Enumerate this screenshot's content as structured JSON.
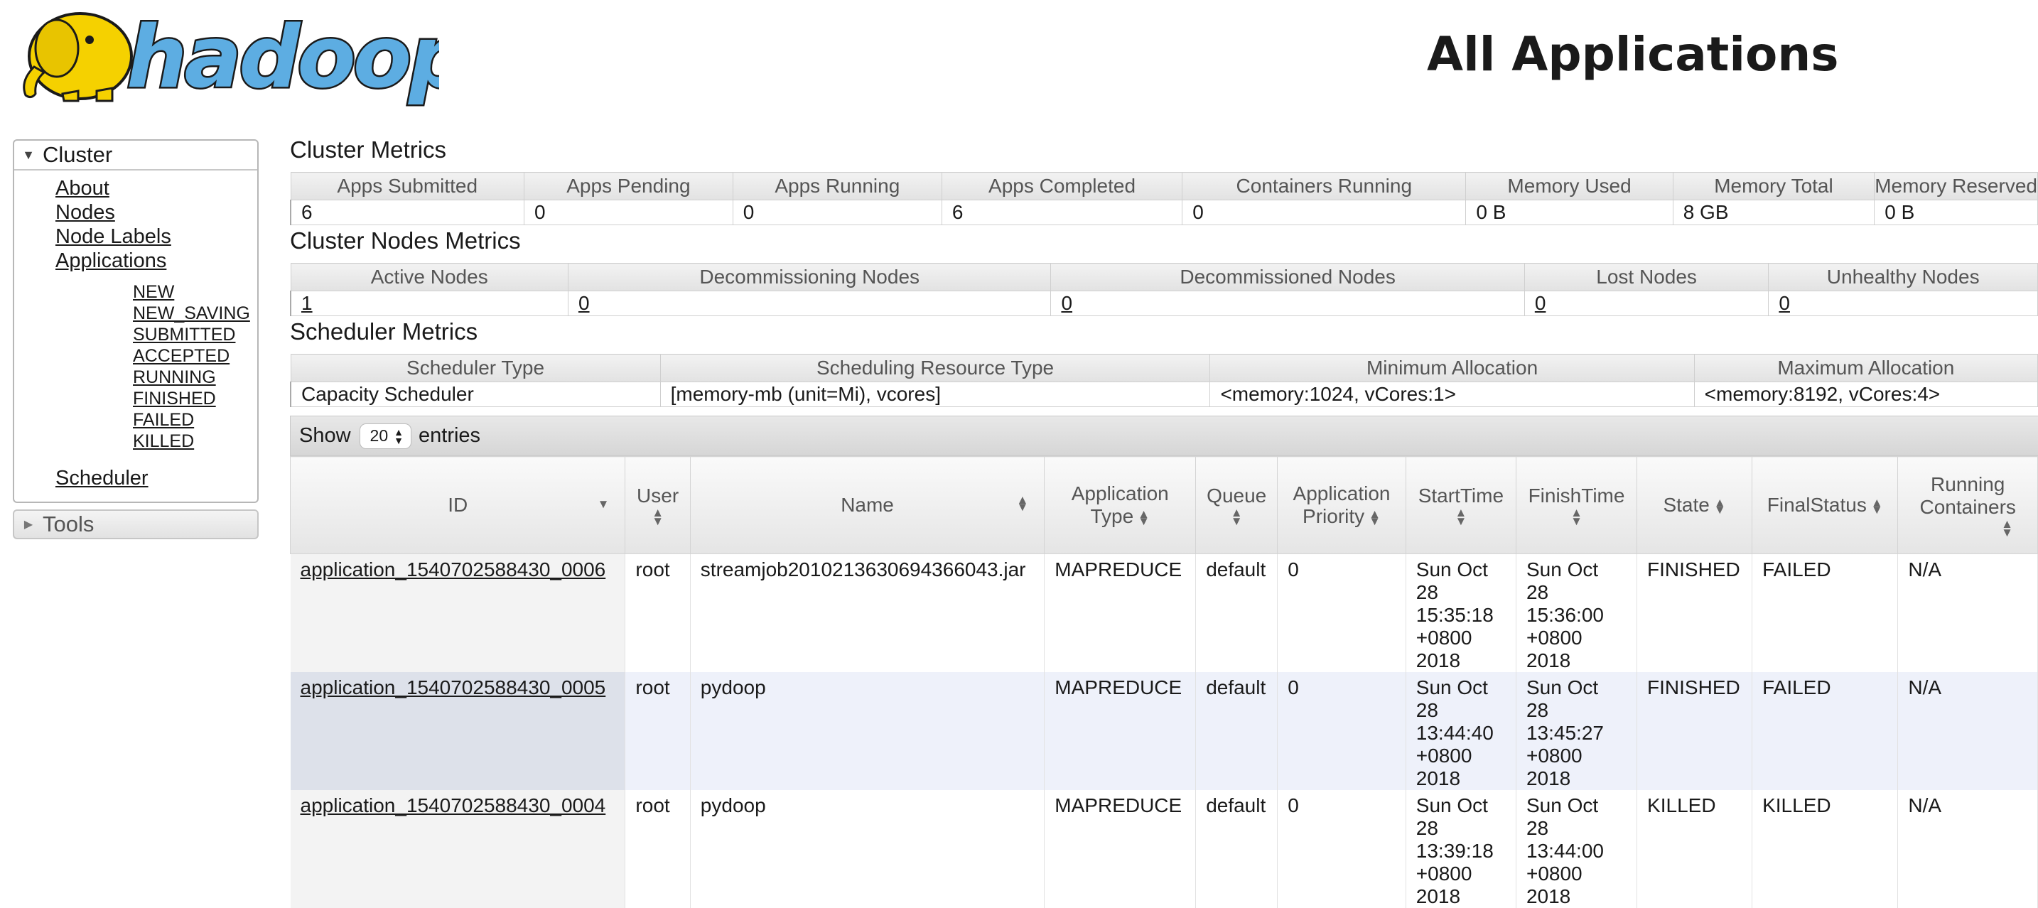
{
  "header": {
    "title": "All Applications",
    "logo_text": "hadoop"
  },
  "sidebar": {
    "cluster_label": "Cluster",
    "links": [
      "About",
      "Nodes",
      "Node Labels",
      "Applications"
    ],
    "app_states": [
      "NEW",
      "NEW_SAVING",
      "SUBMITTED",
      "ACCEPTED",
      "RUNNING",
      "FINISHED",
      "FAILED",
      "KILLED"
    ],
    "scheduler_label": "Scheduler",
    "tools_label": "Tools"
  },
  "cluster_metrics": {
    "title": "Cluster Metrics",
    "headers": [
      "Apps Submitted",
      "Apps Pending",
      "Apps Running",
      "Apps Completed",
      "Containers Running",
      "Memory Used",
      "Memory Total",
      "Memory Reserved"
    ],
    "values": [
      "6",
      "0",
      "0",
      "6",
      "0",
      "0 B",
      "8 GB",
      "0 B"
    ]
  },
  "node_metrics": {
    "title": "Cluster Nodes Metrics",
    "headers": [
      "Active Nodes",
      "Decommissioning Nodes",
      "Decommissioned Nodes",
      "Lost Nodes",
      "Unhealthy Nodes"
    ],
    "values": [
      "1",
      "0",
      "0",
      "0",
      "0"
    ]
  },
  "scheduler_metrics": {
    "title": "Scheduler Metrics",
    "headers": [
      "Scheduler Type",
      "Scheduling Resource Type",
      "Minimum Allocation",
      "Maximum Allocation"
    ],
    "values": [
      "Capacity Scheduler",
      "[memory-mb (unit=Mi), vcores]",
      "<memory:1024, vCores:1>",
      "<memory:8192, vCores:4>"
    ]
  },
  "entries": {
    "show_label": "Show",
    "count": "20",
    "suffix": "entries"
  },
  "apps_table": {
    "columns": [
      {
        "lines": [
          "ID"
        ]
      },
      {
        "lines": [
          "User"
        ]
      },
      {
        "lines": [
          "Name"
        ]
      },
      {
        "lines": [
          "Application",
          "Type"
        ]
      },
      {
        "lines": [
          "Queue"
        ]
      },
      {
        "lines": [
          "Application",
          "Priority"
        ]
      },
      {
        "lines": [
          "StartTime"
        ]
      },
      {
        "lines": [
          "FinishTime"
        ]
      },
      {
        "lines": [
          "State"
        ]
      },
      {
        "lines": [
          "FinalStatus"
        ]
      },
      {
        "lines": [
          "Running",
          "Containers"
        ]
      }
    ],
    "rows": [
      {
        "id": "application_1540702588430_0006",
        "user": "root",
        "name": "streamjob2010213630694366043.jar",
        "type": "MAPREDUCE",
        "queue": "default",
        "priority": "0",
        "start": [
          "Sun Oct",
          "28",
          "15:35:18",
          "+0800",
          "2018"
        ],
        "finish": [
          "Sun Oct",
          "28",
          "15:36:00",
          "+0800",
          "2018"
        ],
        "state": "FINISHED",
        "final_status": "FAILED",
        "running_containers": "N/A"
      },
      {
        "id": "application_1540702588430_0005",
        "user": "root",
        "name": "pydoop",
        "type": "MAPREDUCE",
        "queue": "default",
        "priority": "0",
        "start": [
          "Sun Oct",
          "28",
          "13:44:40",
          "+0800",
          "2018"
        ],
        "finish": [
          "Sun Oct",
          "28",
          "13:45:27",
          "+0800",
          "2018"
        ],
        "state": "FINISHED",
        "final_status": "FAILED",
        "running_containers": "N/A"
      },
      {
        "id": "application_1540702588430_0004",
        "user": "root",
        "name": "pydoop",
        "type": "MAPREDUCE",
        "queue": "default",
        "priority": "0",
        "start": [
          "Sun Oct",
          "28",
          "13:39:18",
          "+0800",
          "2018"
        ],
        "finish": [
          "Sun Oct",
          "28",
          "13:44:00",
          "+0800",
          "2018"
        ],
        "state": "KILLED",
        "final_status": "KILLED",
        "running_containers": "N/A"
      }
    ]
  },
  "colors": {
    "logo_blue": "#5dade2",
    "logo_yellow": "#f5d100",
    "text": "#1a1a1a",
    "even_row": "#eef1fa"
  }
}
